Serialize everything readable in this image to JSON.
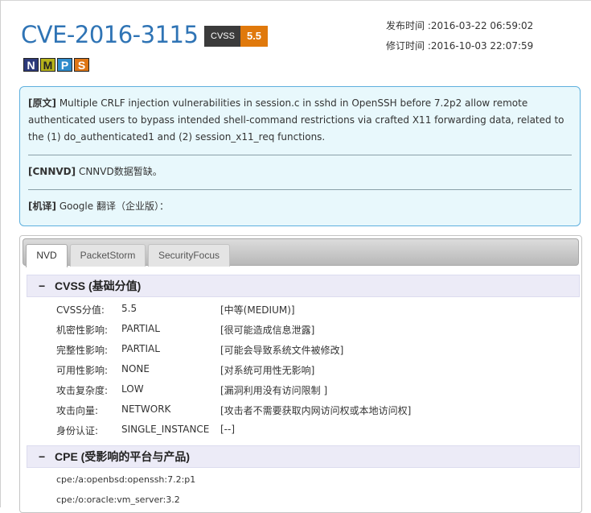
{
  "header": {
    "cve_id": "CVE-2016-3115",
    "cvss_label": "CVSS",
    "cvss_score": "5.5",
    "tags": [
      "N",
      "M",
      "P",
      "S"
    ]
  },
  "dates": {
    "published": "发布时间 :2016-03-22 06:59:02",
    "modified": "修订时间 :2016-10-03 22:07:59"
  },
  "description": {
    "original_label": "[原文]",
    "original_text": "Multiple CRLF injection vulnerabilities in session.c in sshd in OpenSSH before 7.2p2 allow remote authenticated users to bypass intended shell-command restrictions via crafted X11 forwarding data, related to the (1) do_authenticated1 and (2) session_x11_req functions.",
    "cnnvd_label": "[CNNVD]",
    "cnnvd_text": "CNNVD数据暂缺。",
    "mt_label": "[机译]",
    "mt_text": "Google 翻译（企业版）："
  },
  "tabs": [
    {
      "label": "NVD",
      "active": true
    },
    {
      "label": "PacketStorm",
      "active": false
    },
    {
      "label": "SecurityFocus",
      "active": false
    }
  ],
  "cvss_section": {
    "toggle": "−",
    "title": "CVSS (基础分值)",
    "metrics": [
      {
        "key": "CVSS分值:",
        "value": "5.5",
        "desc": "[中等(MEDIUM)]"
      },
      {
        "key": "机密性影响:",
        "value": "PARTIAL",
        "desc": "[很可能造成信息泄露]"
      },
      {
        "key": "完整性影响:",
        "value": "PARTIAL",
        "desc": "[可能会导致系统文件被修改]"
      },
      {
        "key": "可用性影响:",
        "value": "NONE",
        "desc": "[对系统可用性无影响]"
      },
      {
        "key": "攻击复杂度:",
        "value": "LOW",
        "desc": "[漏洞利用没有访问限制 ]"
      },
      {
        "key": "攻击向量:",
        "value": "NETWORK",
        "desc": "[攻击者不需要获取内网访问权或本地访问权]"
      },
      {
        "key": "身份认证:",
        "value": "SINGLE_INSTANCE",
        "desc": "[--]"
      }
    ]
  },
  "cpe_section": {
    "toggle": "−",
    "title": "CPE (受影响的平台与产品)",
    "items": [
      "cpe:/a:openbsd:openssh:7.2:p1",
      "cpe:/o:oracle:vm_server:3.2"
    ]
  }
}
